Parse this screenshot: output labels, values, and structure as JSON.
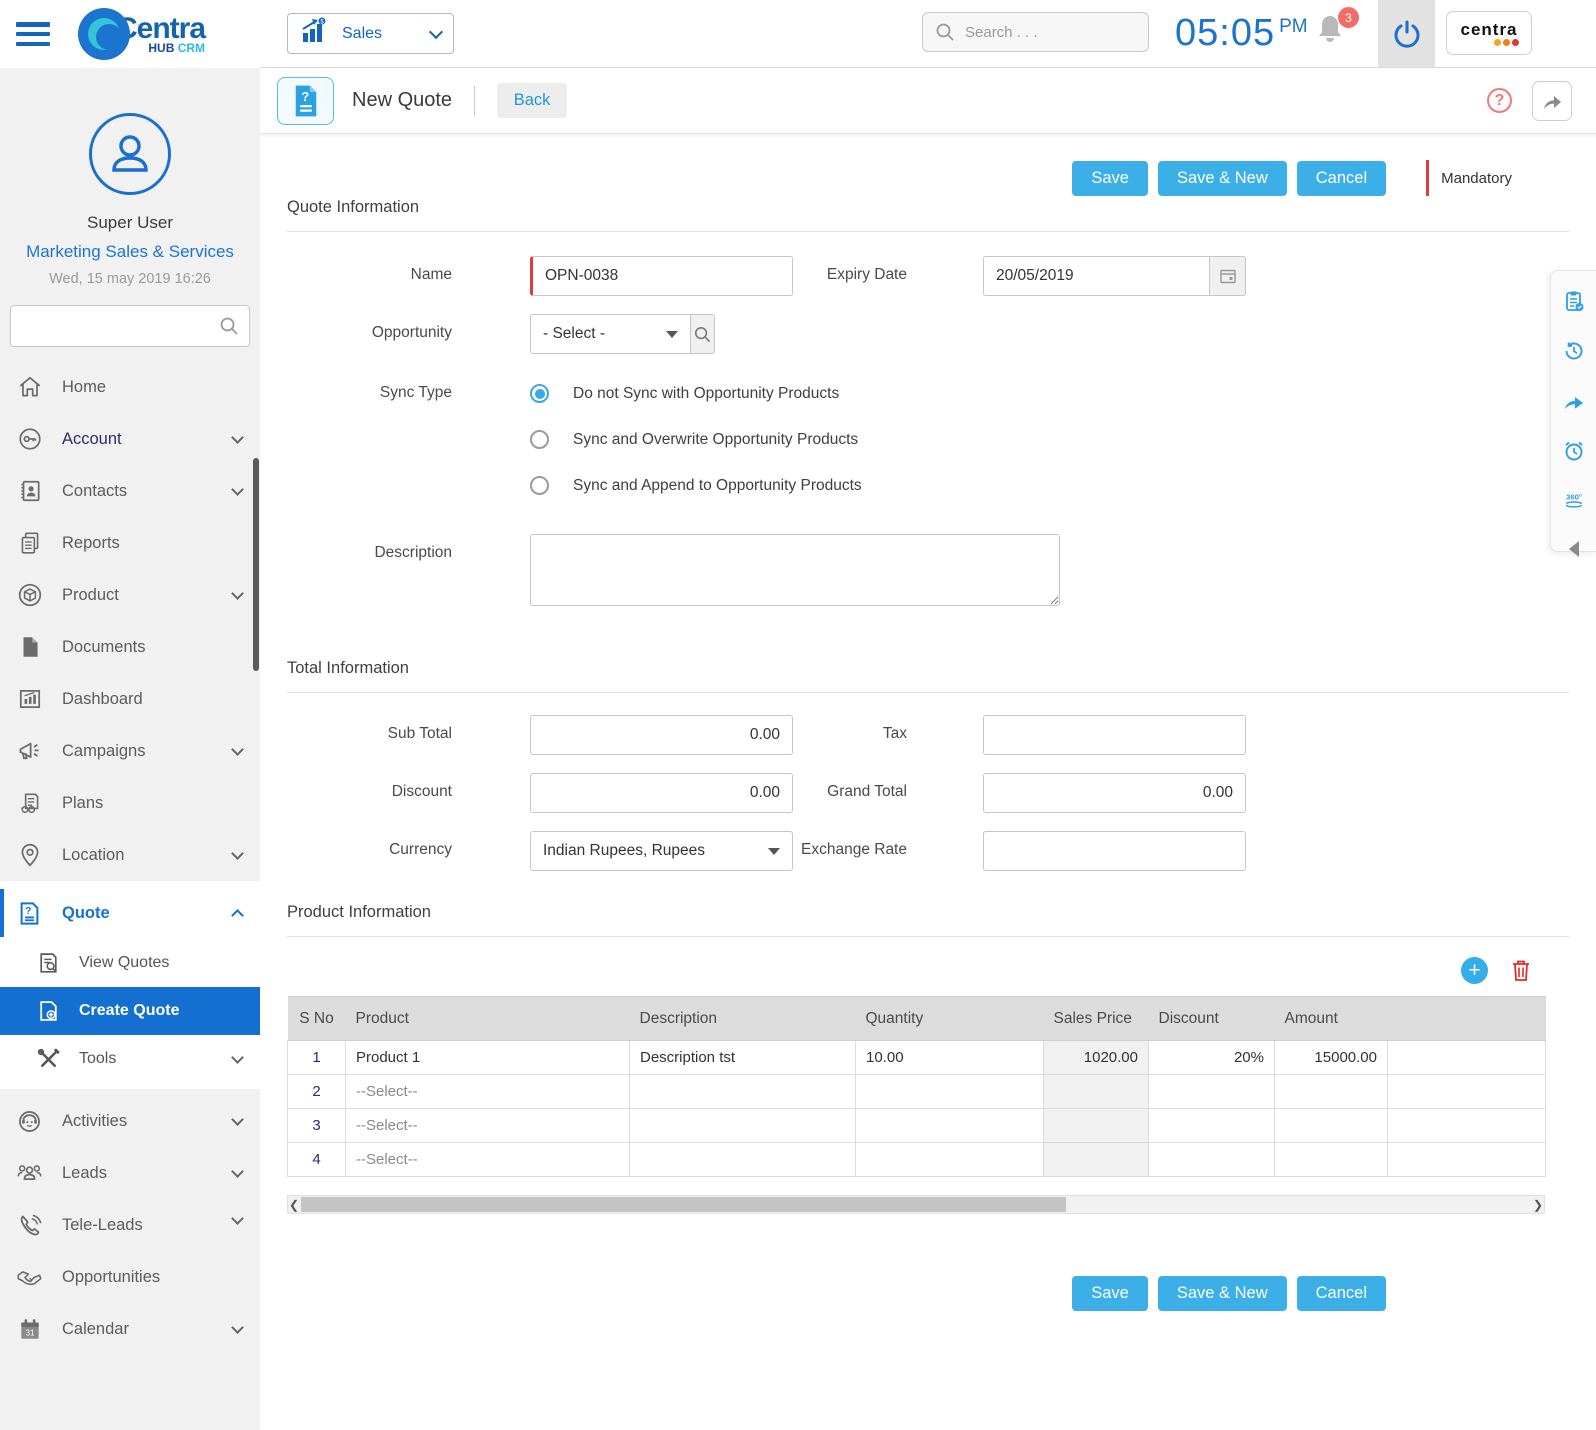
{
  "topbar": {
    "module_selector_label": "Sales",
    "search_placeholder": "Search . . .",
    "time": "05:05",
    "time_period": "PM",
    "notification_count": "3",
    "brand_box_text": "centra"
  },
  "logo": {
    "main": "Centra",
    "hub": "HUB",
    "crm": "CRM"
  },
  "profile": {
    "name": "Super User",
    "department": "Marketing Sales & Services",
    "datetime": "Wed, 15 may 2019 16:26"
  },
  "sidebar": {
    "items": [
      {
        "label": "Home"
      },
      {
        "label": "Account"
      },
      {
        "label": "Contacts"
      },
      {
        "label": "Reports"
      },
      {
        "label": "Product"
      },
      {
        "label": "Documents"
      },
      {
        "label": "Dashboard"
      },
      {
        "label": "Campaigns"
      },
      {
        "label": "Plans"
      },
      {
        "label": "Location"
      }
    ],
    "quote_group": {
      "label": "Quote",
      "sub": [
        {
          "label": "View Quotes"
        },
        {
          "label": "Create Quote"
        },
        {
          "label": "Tools"
        }
      ]
    },
    "lower_items": [
      {
        "label": "Activities"
      },
      {
        "label": "Leads"
      },
      {
        "label": "Tele-Leads"
      },
      {
        "label": "Opportunities"
      },
      {
        "label": "Calendar"
      }
    ]
  },
  "page_header": {
    "title": "New Quote",
    "back_label": "Back"
  },
  "actions": {
    "save": "Save",
    "save_new": "Save & New",
    "cancel": "Cancel",
    "mandatory": "Mandatory"
  },
  "quote_information": {
    "section_title": "Quote Information",
    "name_label": "Name",
    "name_value": "OPN-0038",
    "expiry_label": "Expiry Date",
    "expiry_value": "20/05/2019",
    "opportunity_label": "Opportunity",
    "opportunity_value": "- Select -",
    "sync_type_label": "Sync Type",
    "sync_options": [
      "Do not Sync with Opportunity Products",
      "Sync and Overwrite Opportunity Products",
      "Sync and Append to Opportunity Products"
    ],
    "description_label": "Description"
  },
  "total_information": {
    "section_title": "Total Information",
    "sub_total_label": "Sub Total",
    "sub_total_value": "0.00",
    "tax_label": "Tax",
    "tax_value": "",
    "discount_label": "Discount",
    "discount_value": "0.00",
    "grand_total_label": "Grand Total",
    "grand_total_value": "0.00",
    "currency_label": "Currency",
    "currency_value": "Indian Rupees, Rupees",
    "exchange_rate_label": "Exchange Rate",
    "exchange_rate_value": ""
  },
  "product_information": {
    "section_title": "Product Information",
    "columns": [
      "S No",
      "Product",
      "Description",
      "Quantity",
      "Sales Price",
      "Discount",
      "Amount"
    ],
    "rows": [
      {
        "s_no": "1",
        "product": "Product 1",
        "description": "Description tst",
        "quantity": "10.00",
        "sales_price": "1020.00",
        "discount": "20%",
        "amount": "15000.00"
      },
      {
        "s_no": "2",
        "product": "--Select--",
        "description": "",
        "quantity": "",
        "sales_price": "",
        "discount": "",
        "amount": ""
      },
      {
        "s_no": "3",
        "product": "--Select--",
        "description": "",
        "quantity": "",
        "sales_price": "",
        "discount": "",
        "amount": ""
      },
      {
        "s_no": "4",
        "product": "--Select--",
        "description": "",
        "quantity": "",
        "sales_price": "",
        "discount": "",
        "amount": ""
      }
    ]
  },
  "colors": {
    "accent_blue": "#3cb0e6",
    "link_blue": "#1b75d1",
    "active_nav": "#1470d0",
    "mandatory_red": "#e23b3b"
  }
}
